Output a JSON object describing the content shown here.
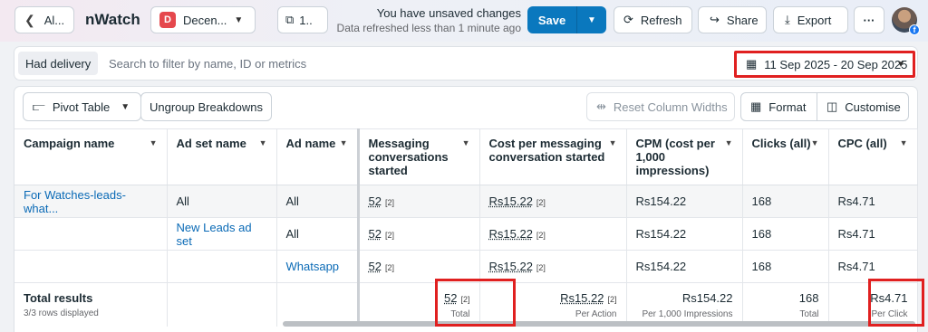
{
  "topbar": {
    "back_label": "Al...",
    "app_name": "nWatch",
    "account_badge": "D",
    "account_label": "Decen...",
    "count_label": "1..",
    "status_main": "You have unsaved changes",
    "status_sub": "Data refreshed less than 1 minute ago",
    "save_label": "Save",
    "refresh_label": "Refresh",
    "share_label": "Share",
    "export_label": "Export",
    "more_label": "···",
    "facebook_badge": "f"
  },
  "filterbar": {
    "chip_label": "Had delivery",
    "placeholder": "Search to filter by name, ID or metrics",
    "date_range": "11 Sep 2025 - 20 Sep 2025"
  },
  "toolbar": {
    "pivot_label": "Pivot Table",
    "ungroup_label": "Ungroup Breakdowns",
    "reset_label": "Reset Column Widths",
    "format_label": "Format",
    "customise_label": "Customise"
  },
  "table": {
    "headers": [
      "Campaign name",
      "Ad set name",
      "Ad name",
      "Messaging conversations started",
      "Cost per messaging conversation started",
      "CPM (cost per 1,000 impressions)",
      "Clicks (all)",
      "CPC (all)"
    ],
    "rows": [
      [
        "For Watches-leads-what...",
        "All",
        "All",
        "52",
        "Rs15.22",
        "Rs154.22",
        "168",
        "Rs4.71"
      ],
      [
        "",
        "New Leads ad set",
        "All",
        "52",
        "Rs15.22",
        "Rs154.22",
        "168",
        "Rs4.71"
      ],
      [
        "",
        "",
        "Whatsapp",
        "52",
        "Rs15.22",
        "Rs154.22",
        "168",
        "Rs4.71"
      ]
    ],
    "footnote": "[2]",
    "total": {
      "title": "Total results",
      "subtitle": "3/3 rows displayed",
      "values": [
        "52",
        "Rs15.22",
        "Rs154.22",
        "168",
        "Rs4.71"
      ],
      "labels": [
        "Total",
        "Per Action",
        "Per 1,000 Impressions",
        "Total",
        "Per Click"
      ]
    }
  }
}
